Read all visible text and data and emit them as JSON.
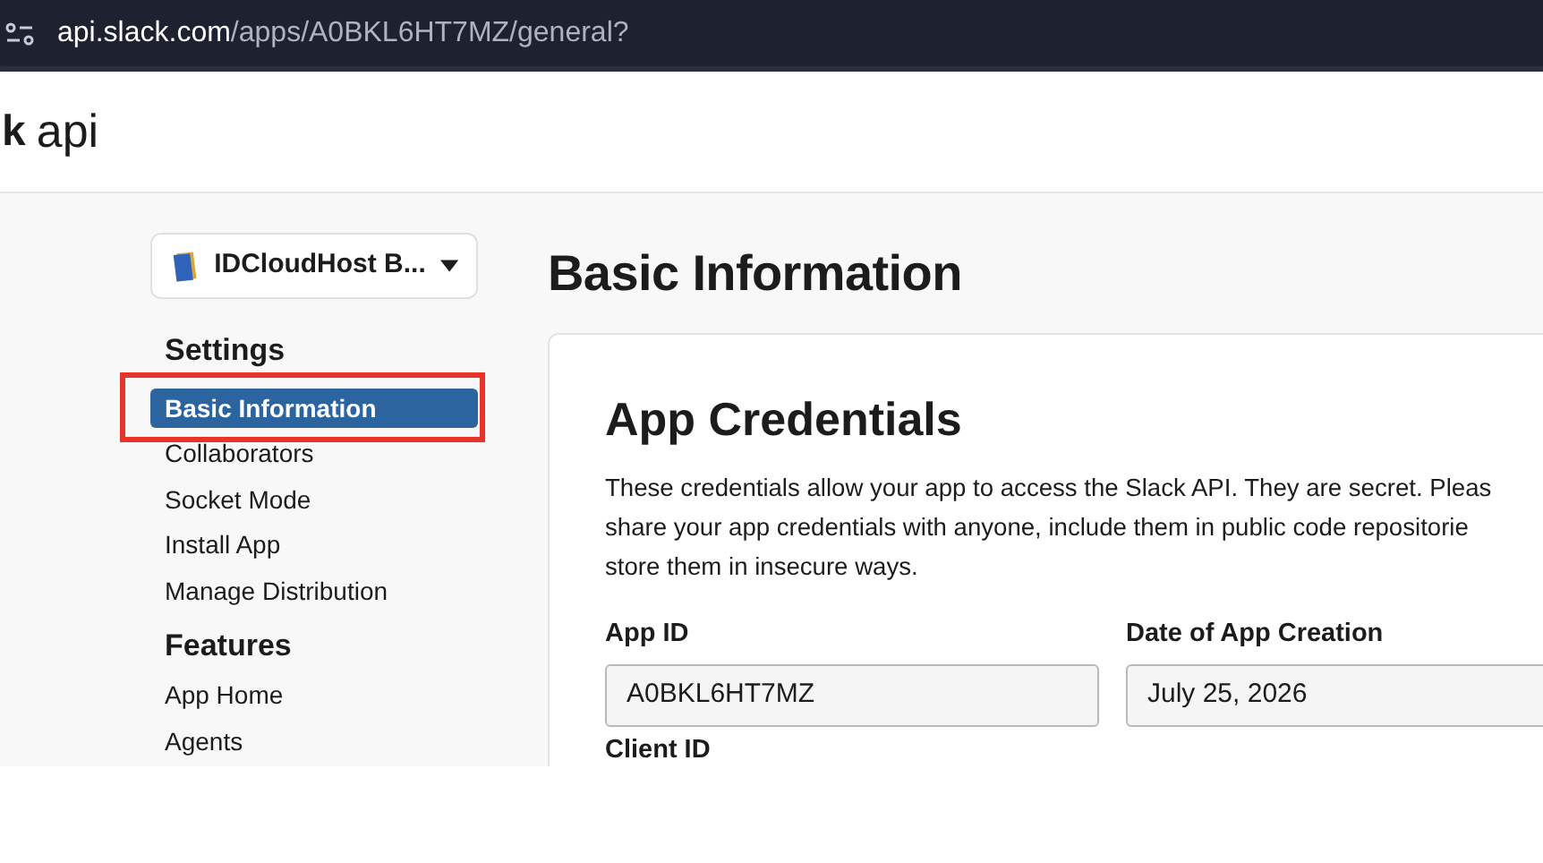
{
  "browser": {
    "url_host": "api.slack.com",
    "url_path": "/apps/A0BKL6HT7MZ/general?"
  },
  "header": {
    "logo_mark": "k",
    "logo_text": "api"
  },
  "sidebar": {
    "app_selector": "IDCloudHost B...",
    "sections": [
      {
        "title": "Settings",
        "items": [
          {
            "label": "Basic Information",
            "selected": true,
            "outlined": true
          },
          {
            "label": "Collaborators",
            "selected": false,
            "outlined": false
          },
          {
            "label": "Socket Mode",
            "selected": false,
            "outlined": false
          },
          {
            "label": "Install App",
            "selected": false,
            "outlined": false
          },
          {
            "label": "Manage Distribution",
            "selected": false,
            "outlined": false
          }
        ]
      },
      {
        "title": "Features",
        "items": [
          {
            "label": "App Home",
            "selected": false,
            "outlined": false
          },
          {
            "label": "Agents",
            "selected": false,
            "outlined": false
          }
        ]
      }
    ]
  },
  "page_title": "Basic Information",
  "card": {
    "title": "App Credentials",
    "description_lines": [
      "These credentials allow your app to access the Slack API. They are secret. Pleas",
      "share your app credentials with anyone, include them in public code repositorie",
      "store them in insecure ways."
    ],
    "fields": [
      {
        "label": "App ID",
        "value": "A0BKL6HT7MZ"
      },
      {
        "label": "Date of App Creation",
        "value": "July 25, 2026"
      }
    ],
    "next_label": "Client ID"
  }
}
